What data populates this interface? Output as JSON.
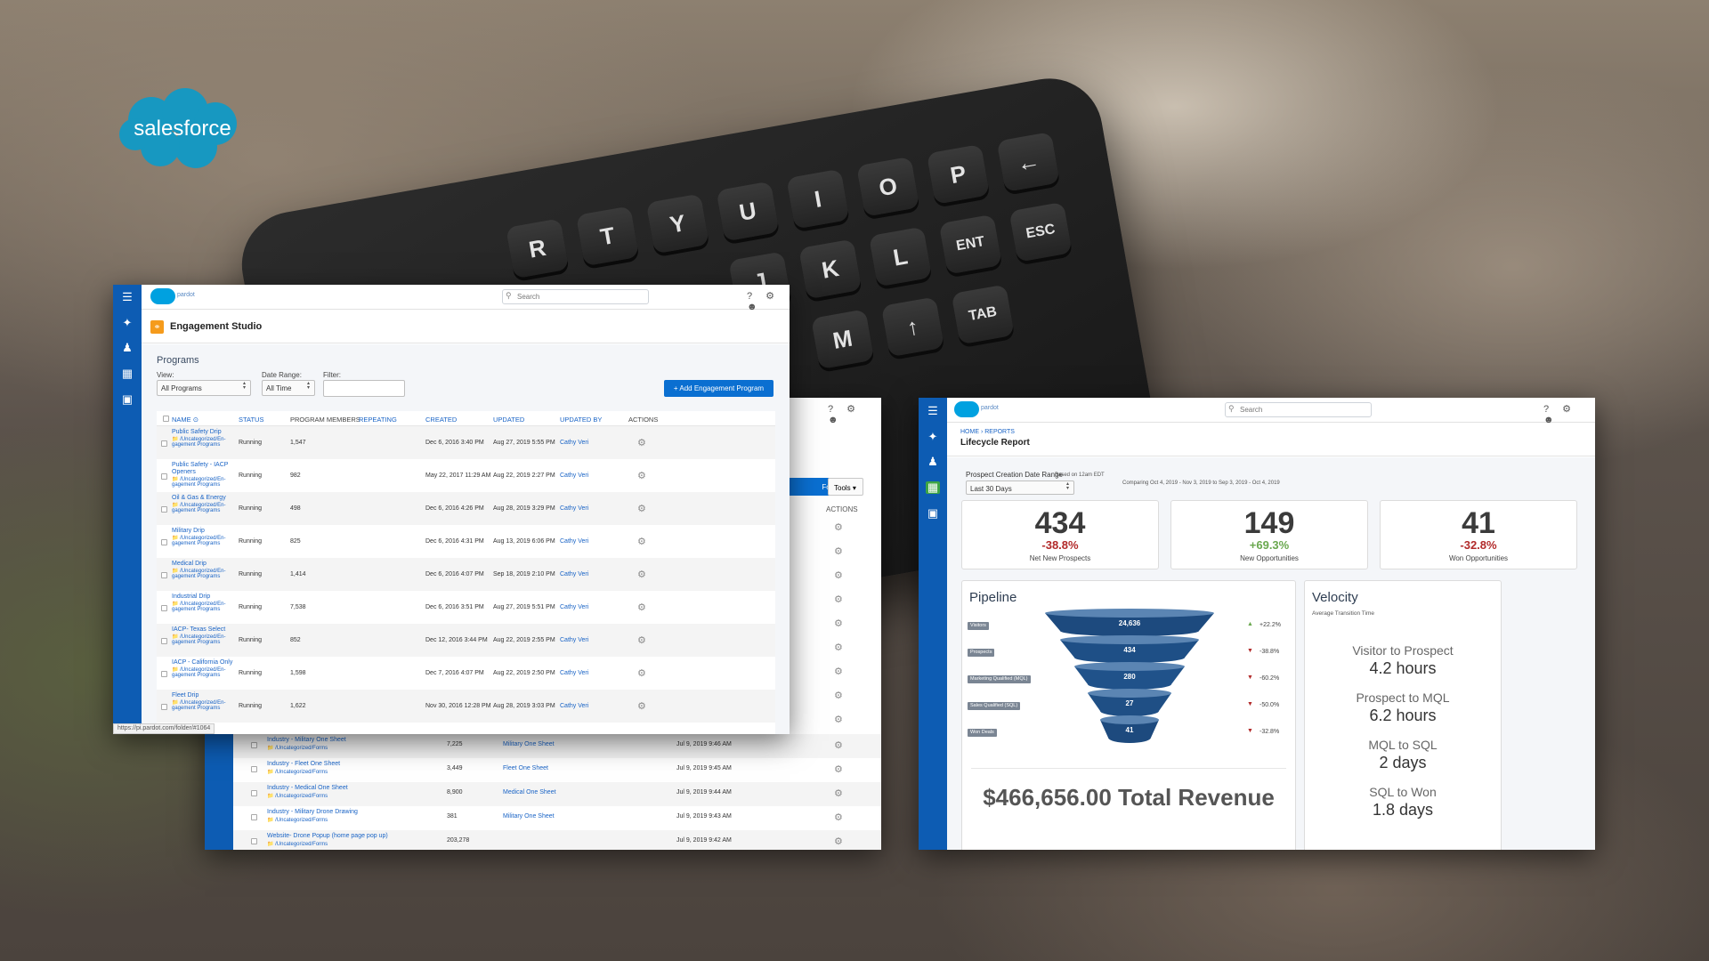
{
  "brand": {
    "logo_text": "salesforce",
    "logo_color": "#1798c1",
    "mini_logo_text": "pardot"
  },
  "accent": {
    "nav_blue": "#0d5cb3",
    "link_blue": "#1a64c6",
    "button_blue": "#0a6fd1",
    "up_green": "#6aa84f",
    "down_red": "#b22a2a"
  },
  "engagement": {
    "search_placeholder": "Search",
    "page_title": "Engagement Studio",
    "section_title": "Programs",
    "view_label": "View:",
    "view_value": "All Programs",
    "date_range_label": "Date Range:",
    "date_range_value": "All Time",
    "filter_label": "Filter:",
    "add_button": "+ Add Engagement Program",
    "columns": [
      "NAME ⊙",
      "STATUS",
      "PROGRAM MEMBERS",
      "REPEATING",
      "CREATED",
      "UPDATED",
      "UPDATED BY",
      "ACTIONS"
    ],
    "rows": [
      {
        "name": "Public Safety Drip",
        "folder": "📁 /Uncategorized/En-",
        "folder2": "gagement Programs",
        "status": "Running",
        "members": "1,547",
        "created": "Dec 6, 2016 3:40 PM",
        "updated": "Aug 27, 2019 5:55 PM",
        "by": "Cathy Veri"
      },
      {
        "name": "Public Safety - IACP",
        "name2": "Openers",
        "folder": "📁 /Uncategorized/En-",
        "folder2": "gagement Programs",
        "status": "Running",
        "members": "982",
        "created": "May 22, 2017 11:29 AM",
        "updated": "Aug 22, 2019 2:27 PM",
        "by": "Cathy Veri"
      },
      {
        "name": "Oil & Gas & Energy",
        "folder": "📁 /Uncategorized/En-",
        "folder2": "gagement Programs",
        "status": "Running",
        "members": "498",
        "created": "Dec 6, 2016 4:26 PM",
        "updated": "Aug 28, 2019 3:29 PM",
        "by": "Cathy Veri"
      },
      {
        "name": "Military Drip",
        "folder": "📁 /Uncategorized/En-",
        "folder2": "gagement Programs",
        "status": "Running",
        "members": "825",
        "created": "Dec 6, 2016 4:31 PM",
        "updated": "Aug 13, 2019 6:06 PM",
        "by": "Cathy Veri"
      },
      {
        "name": "Medical Drip",
        "folder": "📁 /Uncategorized/En-",
        "folder2": "gagement Programs",
        "status": "Running",
        "members": "1,414",
        "created": "Dec 6, 2016 4:07 PM",
        "updated": "Sep 18, 2019 2:10 PM",
        "by": "Cathy Veri"
      },
      {
        "name": "Industrial Drip",
        "folder": "📁 /Uncategorized/En-",
        "folder2": "gagement Programs",
        "status": "Running",
        "members": "7,538",
        "created": "Dec 6, 2016 3:51 PM",
        "updated": "Aug 27, 2019 5:51 PM",
        "by": "Cathy Veri"
      },
      {
        "name": "IACP- Texas Select",
        "folder": "📁 /Uncategorized/En-",
        "folder2": "gagement Programs",
        "status": "Running",
        "members": "852",
        "created": "Dec 12, 2016 3:44 PM",
        "updated": "Aug 22, 2019 2:55 PM",
        "by": "Cathy Veri"
      },
      {
        "name": "IACP - California Only",
        "folder": "📁 /Uncategorized/En-",
        "folder2": "gagement Programs",
        "status": "Running",
        "members": "1,598",
        "created": "Dec 7, 2016 4:07 PM",
        "updated": "Aug 22, 2019 2:50 PM",
        "by": "Cathy Veri"
      },
      {
        "name": "Fleet Drip",
        "folder": "📁 /Uncategorized/En-",
        "folder2": "gagement Programs",
        "status": "Running",
        "members": "1,622",
        "created": "Nov 30, 2016 12:28 PM",
        "updated": "Aug 28, 2019 3:03 PM",
        "by": "Cathy Veri"
      }
    ],
    "status_url": "https://pi.pardot.com/folder/#1064"
  },
  "forms": {
    "form_button": "Form",
    "tools_button": "Tools ▾",
    "actions_header": "ACTIONS",
    "rows": [
      {
        "name": "Industry - Military One Sheet",
        "folder": "📁 /Uncategorized/Forms",
        "count": "7,225",
        "link": "Military One Sheet",
        "date": "Jul 9, 2019 9:46 AM"
      },
      {
        "name": "Industry - Fleet One Sheet",
        "folder": "📁 /Uncategorized/Forms",
        "count": "3,449",
        "link": "Fleet One Sheet",
        "date": "Jul 9, 2019 9:45 AM"
      },
      {
        "name": "Industry - Medical One Sheet",
        "folder": "📁 /Uncategorized/Forms",
        "count": "8,900",
        "link": "Medical One Sheet",
        "date": "Jul 9, 2019 9:44 AM"
      },
      {
        "name": "Industry - Military Drone Drawing",
        "folder": "📁 /Uncategorized/Forms",
        "count": "381",
        "link": "Military One Sheet",
        "date": "Jul 9, 2019 9:43 AM"
      },
      {
        "name": "Website- Drone Popup (home page pop up)",
        "folder": "📁 /Uncategorized/Forms",
        "count": "203,278",
        "link": "",
        "date": "Jul 9, 2019 9:42 AM"
      }
    ]
  },
  "lifecycle": {
    "search_placeholder": "Search",
    "breadcrumb": "HOME › REPORTS",
    "title": "Lifecycle Report",
    "date_label": "Prospect Creation Date Range",
    "date_note": "Based on 12am EDT",
    "date_value": "Last 30 Days",
    "comparing": "Comparing Oct 4, 2019 - Nov 3, 2019 to Sep 3, 2019 - Oct 4, 2019",
    "kpis": [
      {
        "value": "434",
        "change": "-38.8%",
        "label": "Net New Prospects",
        "dir": "down"
      },
      {
        "value": "149",
        "change": "+69.3%",
        "label": "New Opportunities",
        "dir": "up"
      },
      {
        "value": "41",
        "change": "-32.8%",
        "label": "Won Opportunities",
        "dir": "down"
      }
    ],
    "pipeline_title": "Pipeline",
    "funnel": [
      {
        "stage": "Visitors",
        "value": "24,636",
        "delta": "+22.2%",
        "dir": "up"
      },
      {
        "stage": "Prospects",
        "value": "434",
        "delta": "-38.8%",
        "dir": "down"
      },
      {
        "stage": "Marketing Qualified (MQL)",
        "value": "280",
        "delta": "-60.2%",
        "dir": "down"
      },
      {
        "stage": "Sales Qualified (SQL)",
        "value": "27",
        "delta": "-50.0%",
        "dir": "down"
      },
      {
        "stage": "Won Deals",
        "value": "41",
        "delta": "-32.8%",
        "dir": "down"
      }
    ],
    "total_revenue": "$466,656.00 Total Revenue",
    "velocity_title": "Velocity",
    "velocity_sub": "Average Transition Time",
    "velocity": [
      {
        "label": "Visitor to Prospect",
        "value": "4.2 hours"
      },
      {
        "label": "Prospect to MQL",
        "value": "6.2 hours"
      },
      {
        "label": "MQL to SQL",
        "value": "2 days"
      },
      {
        "label": "SQL to Won",
        "value": "1.8 days"
      }
    ]
  }
}
